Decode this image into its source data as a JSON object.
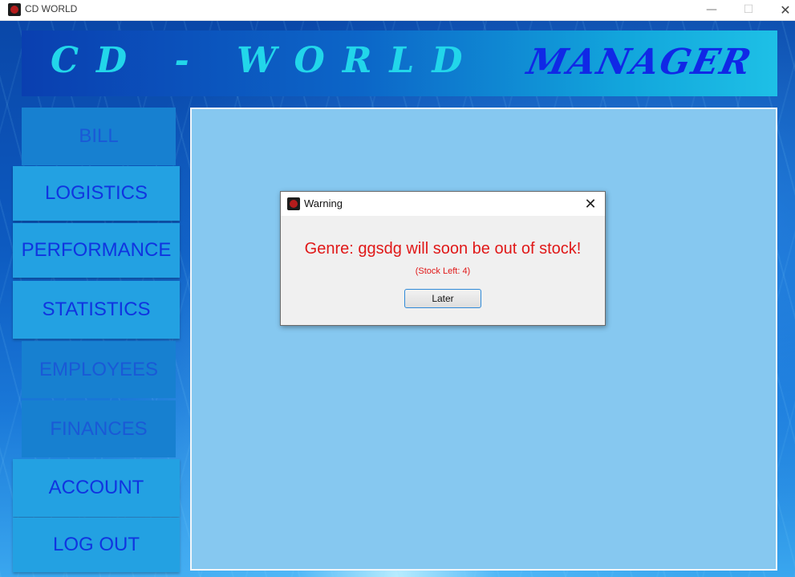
{
  "window": {
    "title": "CD WORLD",
    "controls": {
      "minimize": "—",
      "maximize": "☐",
      "close": "✕"
    }
  },
  "header": {
    "brand": "CD - WORLD",
    "role": "MANAGER"
  },
  "sidebar": {
    "items": [
      {
        "label": "BILL"
      },
      {
        "label": "LOGISTICS"
      },
      {
        "label": "PERFORMANCE"
      },
      {
        "label": "STATISTICS"
      },
      {
        "label": "EMPLOYEES"
      },
      {
        "label": "FINANCES"
      },
      {
        "label": "ACCOUNT"
      },
      {
        "label": "LOG OUT"
      }
    ]
  },
  "dialog": {
    "title": "Warning",
    "close_glyph": "✕",
    "message": "Genre: ggsdg will soon be out of stock!",
    "sub_message": "(Stock Left: 4)",
    "button_label": "Later"
  },
  "colors": {
    "accent": "#23a1e2",
    "nav_text": "#1034e0",
    "warning_text": "#e01818",
    "content_bg": "#86c8f0"
  }
}
